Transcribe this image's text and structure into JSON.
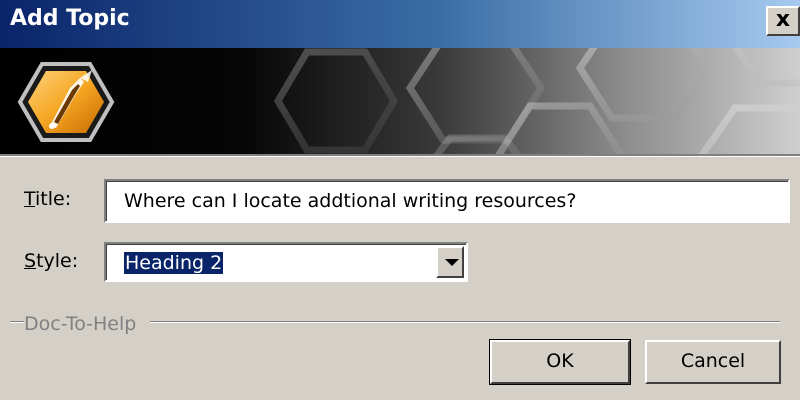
{
  "window": {
    "title": "Add Topic",
    "close_label": "x"
  },
  "banner": {
    "logo_icon": "pen-nib-hexagon-icon"
  },
  "form": {
    "title_label_hotkey": "T",
    "title_label_rest": "itle:",
    "title_value": "Where can I locate addtional writing resources?",
    "style_label_hotkey": "S",
    "style_label_rest": "tyle:",
    "style_value": "Heading 2"
  },
  "group": {
    "label": "Doc-To-Help"
  },
  "buttons": {
    "ok_label": "OK",
    "cancel_label": "Cancel"
  },
  "colors": {
    "titlebar_start": "#0a246a",
    "titlebar_end": "#a6caf0",
    "dialog_bg": "#d4d0c8",
    "selection_bg": "#0a246a",
    "logo_orange": "#f5a623"
  }
}
